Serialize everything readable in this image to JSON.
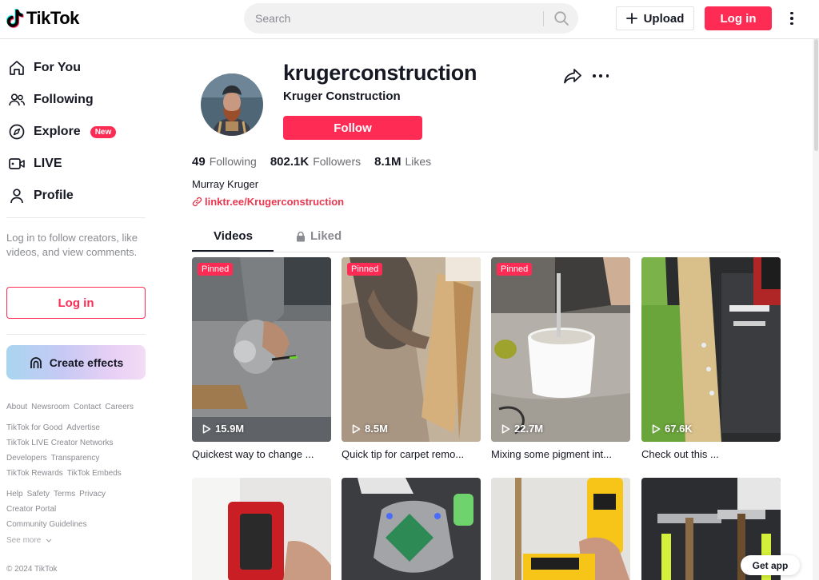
{
  "header": {
    "brand": "TikTok",
    "search_placeholder": "Search",
    "upload_label": "Upload",
    "login_label": "Log in"
  },
  "sidebar": {
    "items": [
      {
        "label": "For You",
        "icon": "home-icon"
      },
      {
        "label": "Following",
        "icon": "users-icon"
      },
      {
        "label": "Explore",
        "icon": "compass-icon",
        "badge": "New"
      },
      {
        "label": "LIVE",
        "icon": "live-icon"
      },
      {
        "label": "Profile",
        "icon": "person-icon"
      }
    ],
    "login_hint": "Log in to follow creators, like videos, and view comments.",
    "login_label": "Log in",
    "effects_label": "Create effects",
    "footer_links": [
      [
        "About",
        "Newsroom",
        "Contact",
        "Careers"
      ],
      [
        "TikTok for Good",
        "Advertise"
      ],
      [
        "TikTok LIVE Creator Networks"
      ],
      [
        "Developers",
        "Transparency"
      ],
      [
        "TikTok Rewards",
        "TikTok Embeds"
      ],
      [
        "Help",
        "Safety",
        "Terms",
        "Privacy"
      ],
      [
        "Creator Portal"
      ],
      [
        "Community Guidelines"
      ]
    ],
    "see_more": "See more",
    "copyright": "© 2024 TikTok"
  },
  "profile": {
    "username": "krugerconstruction",
    "nickname": "Kruger Construction",
    "follow_label": "Follow",
    "stats": [
      {
        "value": "49",
        "label": "Following"
      },
      {
        "value": "802.1K",
        "label": "Followers"
      },
      {
        "value": "8.1M",
        "label": "Likes"
      }
    ],
    "bio": "Murray Kruger",
    "link": "linktr.ee/Krugerconstruction"
  },
  "tabs": {
    "videos": "Videos",
    "liked": "Liked"
  },
  "videos": [
    {
      "pinned": "Pinned",
      "views": "15.9M",
      "caption": "Quickest way to change ..."
    },
    {
      "pinned": "Pinned",
      "views": "8.5M",
      "caption": "Quick tip for carpet remo..."
    },
    {
      "pinned": "Pinned",
      "views": "22.7M",
      "caption": "Mixing some pigment int..."
    },
    {
      "pinned": "",
      "views": "67.6K",
      "caption": "Check out this ..."
    }
  ],
  "get_app": "Get app",
  "colors": {
    "brand_red": "#fe2c55",
    "link_red": "#e8384f",
    "text": "#161823",
    "muted": "#8a8b91"
  }
}
